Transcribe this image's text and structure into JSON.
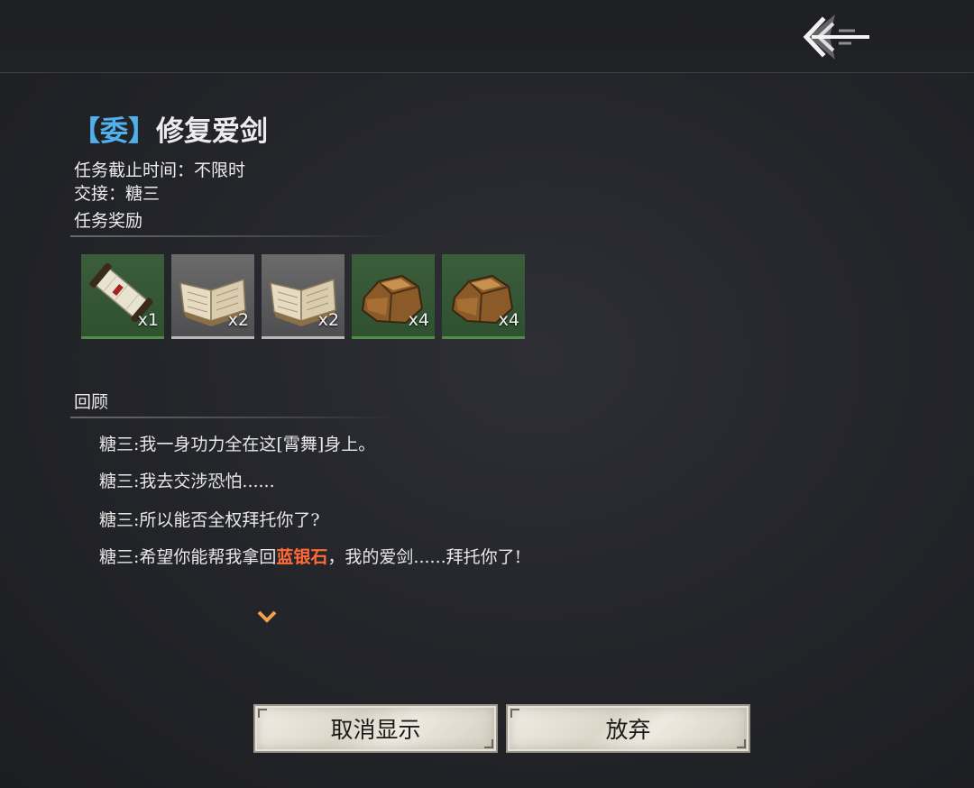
{
  "header": {
    "back_icon": "back-arrow-icon"
  },
  "quest": {
    "bracket_left": "【",
    "tag": "委",
    "bracket_right": "】",
    "title": "修复爱剑",
    "deadline": "任务截止时间：不限时",
    "submit_to": "交接：糖三",
    "rewards_label": "任务奖励"
  },
  "rewards": [
    {
      "icon": "scroll-icon",
      "qty": "x1",
      "frame_color": "#2f5130"
    },
    {
      "icon": "book-icon",
      "qty": "x2",
      "frame_color": "#4f4f52"
    },
    {
      "icon": "book-icon",
      "qty": "x2",
      "frame_color": "#4f4f52"
    },
    {
      "icon": "ore-icon",
      "qty": "x4",
      "frame_color": "#2f5130"
    },
    {
      "icon": "ore-icon",
      "qty": "x4",
      "frame_color": "#2f5130"
    }
  ],
  "review": {
    "label": "回顾",
    "lines": [
      "糖三:我一身功力全在这[霄舞]身上。",
      "糖三:我去交涉恐怕......",
      "糖三:所以能否全权拜托你了?"
    ],
    "last_line": {
      "before": "糖三:希望你能帮我拿回",
      "highlight": "蓝银石",
      "after": "，我的爱剑......拜托你了!"
    },
    "highlight_color": "#ff6a35"
  },
  "buttons": {
    "hide_label": "取消显示",
    "abandon_label": "放弃"
  }
}
